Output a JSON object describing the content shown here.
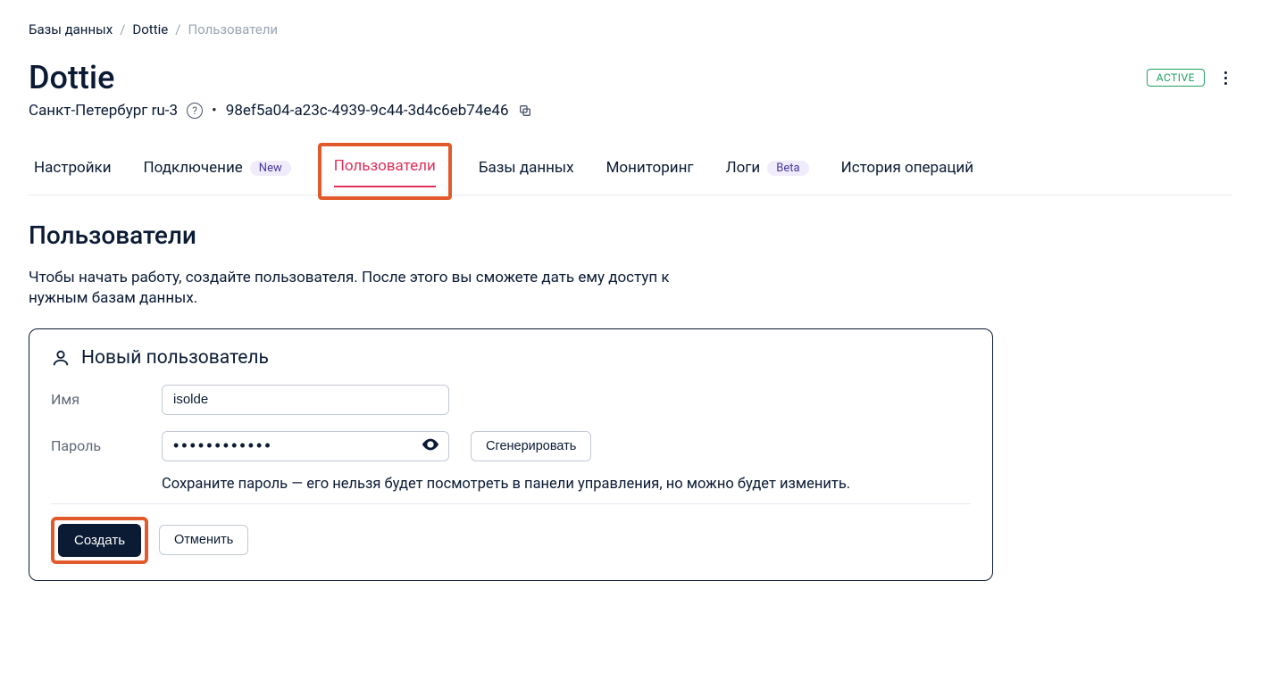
{
  "breadcrumb": {
    "items": [
      "Базы данных",
      "Dottie",
      "Пользователи"
    ]
  },
  "header": {
    "title": "Dottie",
    "status": "ACTIVE",
    "region": "Санкт-Петербург ru-3",
    "uuid": "98ef5a04-a23c-4939-9c44-3d4c6eb74e46"
  },
  "tabs": {
    "settings": "Настройки",
    "connection": "Подключение",
    "connection_chip": "New",
    "users": "Пользователи",
    "databases": "Базы данных",
    "monitoring": "Мониторинг",
    "logs": "Логи",
    "logs_chip": "Beta",
    "history": "История операций"
  },
  "section": {
    "title": "Пользователи",
    "intro": "Чтобы начать работу, создайте пользователя. После этого вы сможете дать ему доступ к нужным базам данных."
  },
  "form": {
    "card_title": "Новый пользователь",
    "name_label": "Имя",
    "name_value": "isolde",
    "password_label": "Пароль",
    "password_masked": "••••••••••••",
    "generate_label": "Сгенерировать",
    "password_hint": "Сохраните пароль — его нельзя будет посмотреть в панели управления, но можно будет изменить.",
    "create_label": "Создать",
    "cancel_label": "Отменить"
  }
}
